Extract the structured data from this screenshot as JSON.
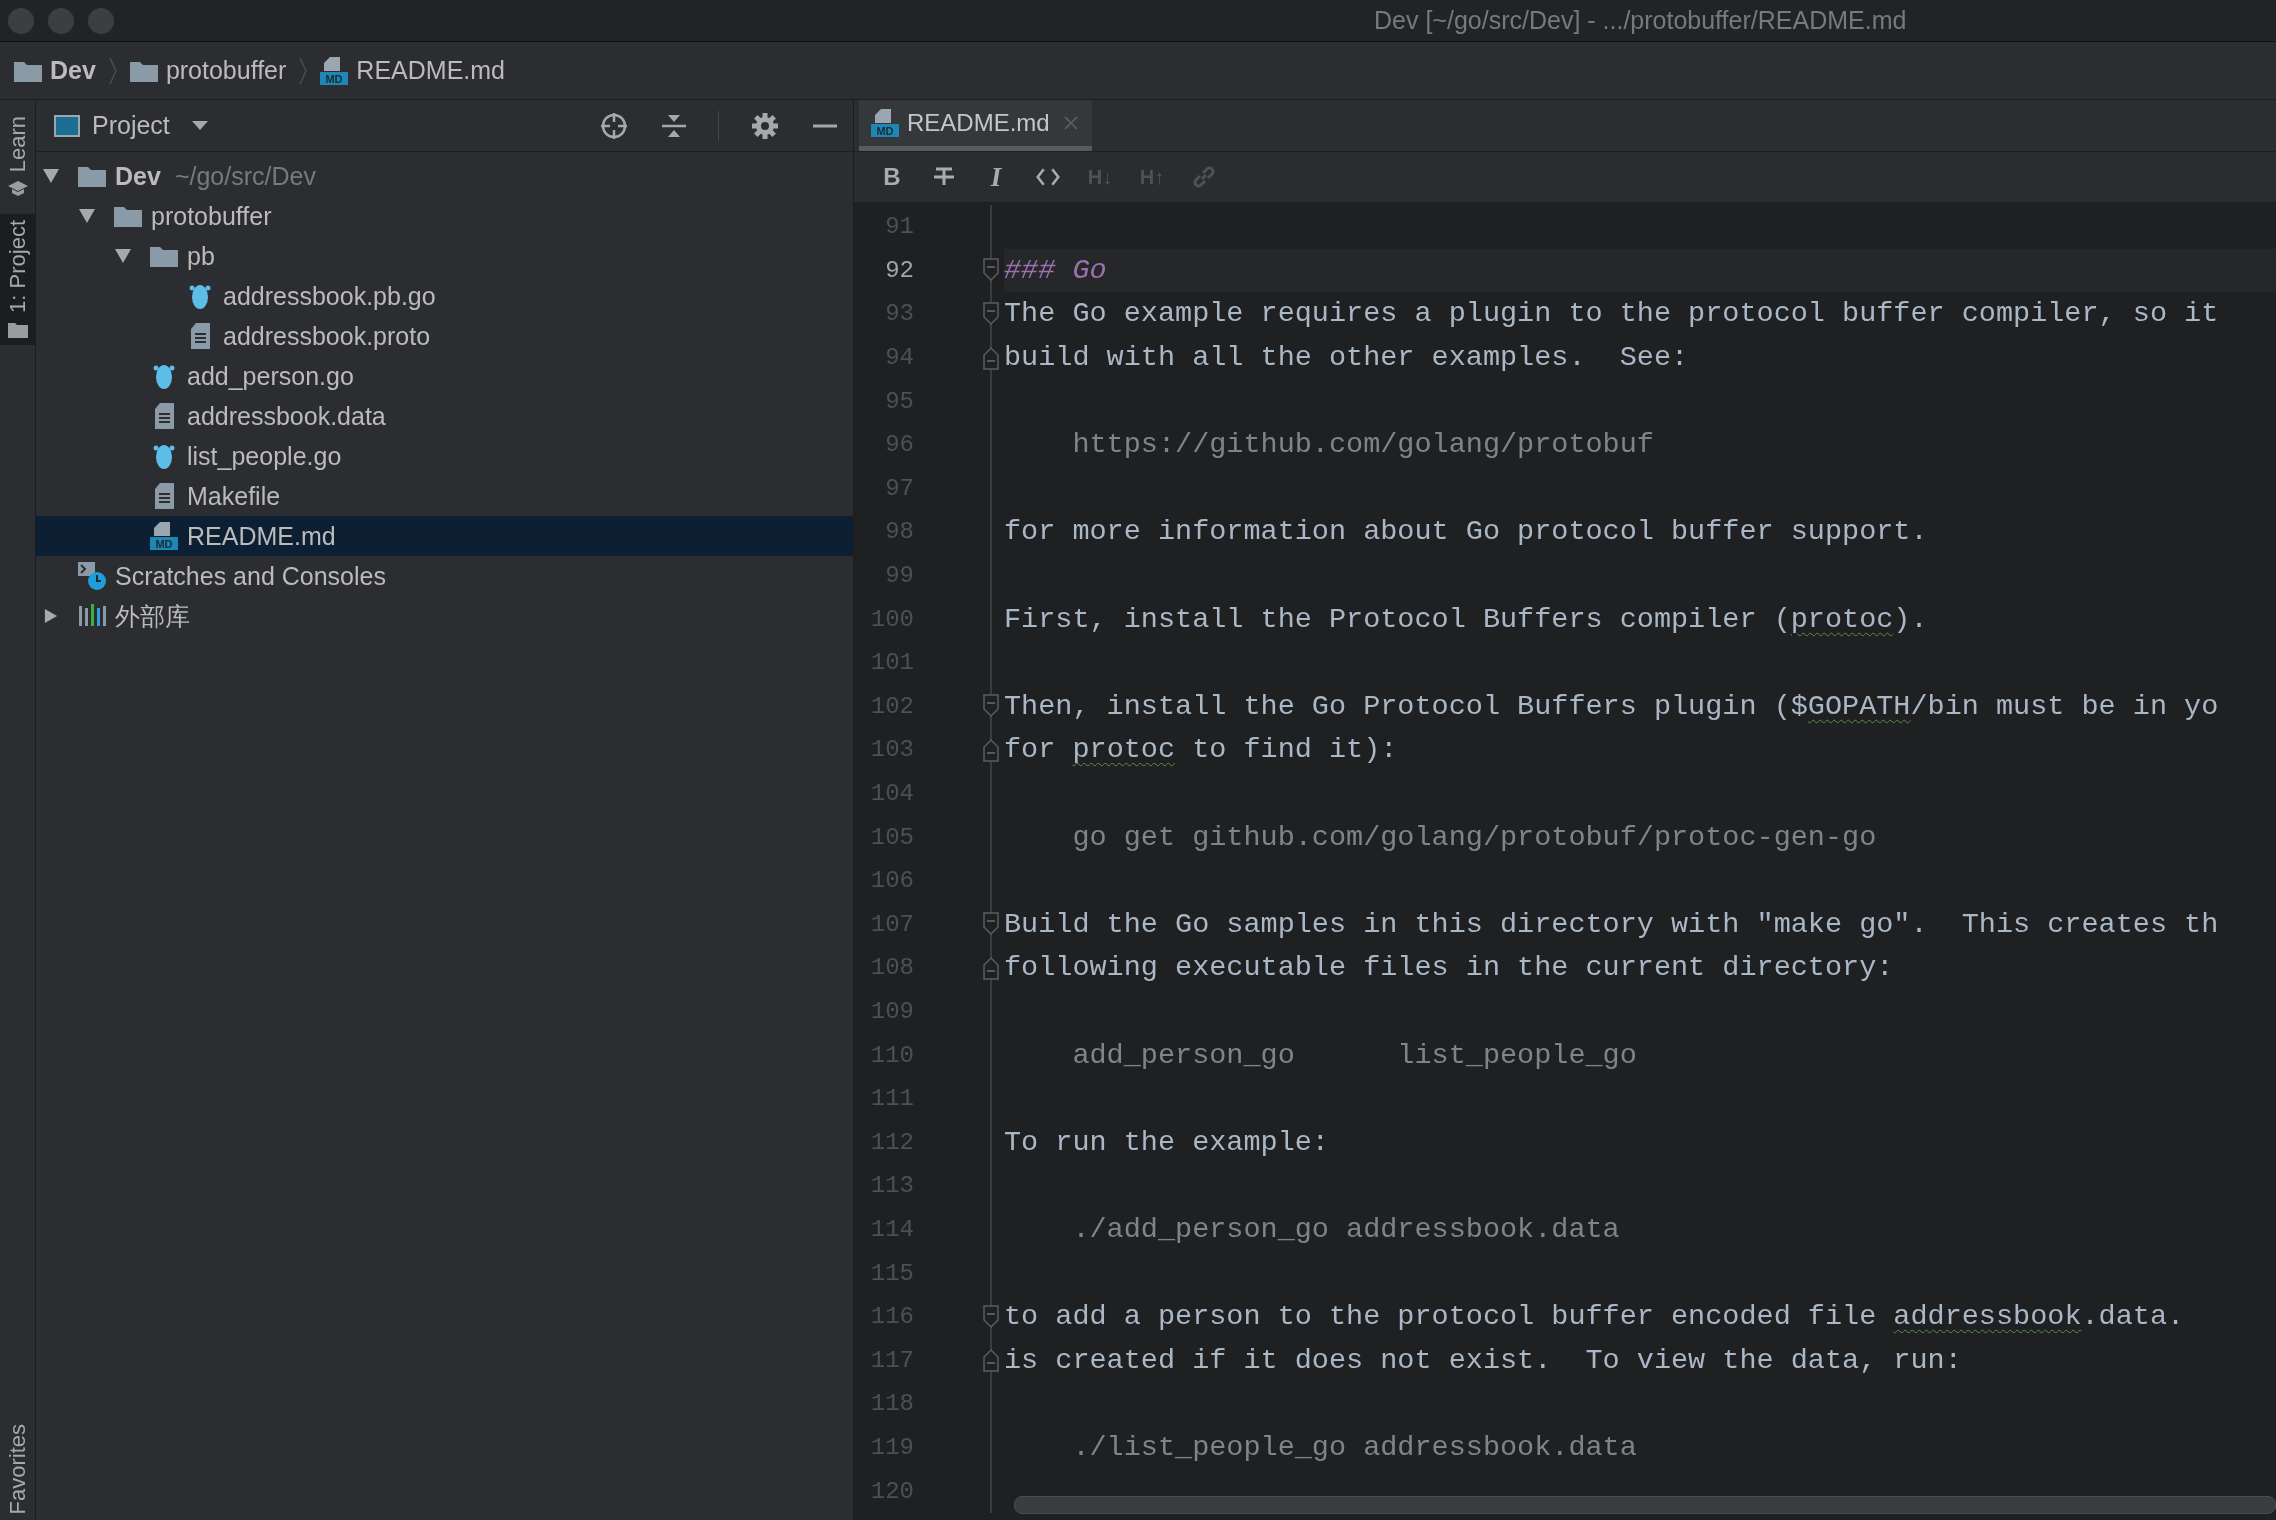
{
  "window": {
    "title": "Dev [~/go/src/Dev] - .../protobuffer/README.md"
  },
  "breadcrumbs": [
    {
      "label": "Dev",
      "kind": "folder",
      "bold": true
    },
    {
      "label": "protobuffer",
      "kind": "folder",
      "bold": false
    },
    {
      "label": "README.md",
      "kind": "markdown",
      "icon_label": "MD",
      "bold": false
    }
  ],
  "tool_strip": {
    "top": [
      {
        "label": "Learn",
        "kind": "cap",
        "selected": false
      },
      {
        "label": "1: Project",
        "kind": "folder",
        "selected": true
      }
    ],
    "bottom": [
      {
        "label": "Favorites",
        "selected": false
      }
    ]
  },
  "project": {
    "title": "Project",
    "tree": [
      {
        "label": "Dev",
        "hint": "~/go/src/Dev",
        "bold": true,
        "kind": "folder",
        "expanded": true,
        "selected": false,
        "children": [
          {
            "label": "protobuffer",
            "bold": false,
            "kind": "folder",
            "expanded": true,
            "selected": false,
            "children": [
              {
                "label": "pb",
                "bold": false,
                "kind": "folder",
                "expanded": true,
                "selected": false,
                "children": [
                  {
                    "label": "addressbook.pb.go",
                    "bold": false,
                    "kind": "go",
                    "selected": false
                  },
                  {
                    "label": "addressbook.proto",
                    "bold": false,
                    "kind": "file",
                    "selected": false
                  }
                ]
              },
              {
                "label": "add_person.go",
                "bold": false,
                "kind": "go",
                "selected": false
              },
              {
                "label": "addressbook.data",
                "bold": false,
                "kind": "file",
                "selected": false
              },
              {
                "label": "list_people.go",
                "bold": false,
                "kind": "go",
                "selected": false
              },
              {
                "label": "Makefile",
                "bold": false,
                "kind": "file",
                "selected": false
              },
              {
                "label": "README.md",
                "bold": false,
                "kind": "markdown",
                "icon_label": "MD",
                "selected": true
              }
            ]
          }
        ]
      },
      {
        "label": "Scratches and Consoles",
        "bold": false,
        "kind": "scratches",
        "selected": false
      },
      {
        "label": "外部库",
        "bold": false,
        "kind": "library",
        "expanded": false,
        "selected": false
      }
    ]
  },
  "editor": {
    "tabs": [
      {
        "label": "README.md",
        "kind": "markdown",
        "icon_label": "MD",
        "selected": true
      }
    ],
    "toolbar": [
      {
        "kind": "bold",
        "label": "B",
        "disabled": false
      },
      {
        "kind": "strike",
        "disabled": false
      },
      {
        "kind": "italic",
        "label": "I",
        "disabled": false
      },
      {
        "kind": "code",
        "disabled": false
      },
      {
        "kind": "header",
        "label": "H↓",
        "disabled": true
      },
      {
        "kind": "header",
        "label": "H↑",
        "disabled": true
      },
      {
        "kind": "link",
        "disabled": true
      }
    ],
    "lines": [
      {
        "number": "91",
        "current": false,
        "fold_start": false,
        "fold_end": false
      },
      {
        "number": "92",
        "kind": "heading",
        "current": true,
        "fold_start": true,
        "fold_end": false,
        "segments": [
          {
            "text": "### Go",
            "flagged": false
          }
        ]
      },
      {
        "number": "93",
        "kind": "text",
        "current": false,
        "fold_start": true,
        "fold_end": false,
        "segments": [
          {
            "text": "The Go example requires a plugin to the protocol buffer compiler, so it",
            "flagged": false
          }
        ]
      },
      {
        "number": "94",
        "kind": "text",
        "current": false,
        "fold_start": false,
        "fold_end": true,
        "segments": [
          {
            "text": "build with all the other examples.  See:",
            "flagged": false
          }
        ]
      },
      {
        "number": "95",
        "current": false,
        "fold_start": false,
        "fold_end": false
      },
      {
        "number": "96",
        "kind": "code",
        "current": false,
        "fold_start": false,
        "fold_end": false,
        "segments": [
          {
            "text": "    https://github.com/golang/protobuf",
            "flagged": false
          }
        ]
      },
      {
        "number": "97",
        "current": false,
        "fold_start": false,
        "fold_end": false
      },
      {
        "number": "98",
        "kind": "text",
        "current": false,
        "fold_start": false,
        "fold_end": false,
        "segments": [
          {
            "text": "for more information about Go protocol buffer support.",
            "flagged": false
          }
        ]
      },
      {
        "number": "99",
        "current": false,
        "fold_start": false,
        "fold_end": false
      },
      {
        "number": "100",
        "kind": "text",
        "current": false,
        "fold_start": false,
        "fold_end": false,
        "segments": [
          {
            "text": "First, install the Protocol Buffers compiler (",
            "flagged": false
          },
          {
            "text": "protoc",
            "flagged": true
          },
          {
            "text": ").",
            "flagged": false
          }
        ]
      },
      {
        "number": "101",
        "current": false,
        "fold_start": false,
        "fold_end": false
      },
      {
        "number": "102",
        "kind": "text",
        "current": false,
        "fold_start": true,
        "fold_end": false,
        "segments": [
          {
            "text": "Then, install the Go Protocol Buffers plugin ($",
            "flagged": false
          },
          {
            "text": "GOPATH",
            "flagged": true
          },
          {
            "text": "/bin must be in yo",
            "flagged": false
          }
        ]
      },
      {
        "number": "103",
        "kind": "text",
        "current": false,
        "fold_start": false,
        "fold_end": true,
        "segments": [
          {
            "text": "for ",
            "flagged": false
          },
          {
            "text": "protoc",
            "flagged": true
          },
          {
            "text": " to find it):",
            "flagged": false
          }
        ]
      },
      {
        "number": "104",
        "current": false,
        "fold_start": false,
        "fold_end": false
      },
      {
        "number": "105",
        "kind": "code",
        "current": false,
        "fold_start": false,
        "fold_end": false,
        "segments": [
          {
            "text": "    go get github.com/golang/protobuf/protoc-gen-go",
            "flagged": false
          }
        ]
      },
      {
        "number": "106",
        "current": false,
        "fold_start": false,
        "fold_end": false
      },
      {
        "number": "107",
        "kind": "text",
        "current": false,
        "fold_start": true,
        "fold_end": false,
        "segments": [
          {
            "text": "Build the Go samples in this directory with \"make go\".  This creates th",
            "flagged": false
          }
        ]
      },
      {
        "number": "108",
        "kind": "text",
        "current": false,
        "fold_start": false,
        "fold_end": true,
        "segments": [
          {
            "text": "following executable files in the current directory:",
            "flagged": false
          }
        ]
      },
      {
        "number": "109",
        "current": false,
        "fold_start": false,
        "fold_end": false
      },
      {
        "number": "110",
        "kind": "code",
        "current": false,
        "fold_start": false,
        "fold_end": false,
        "segments": [
          {
            "text": "    add_person_go      list_people_go",
            "flagged": false
          }
        ]
      },
      {
        "number": "111",
        "current": false,
        "fold_start": false,
        "fold_end": false
      },
      {
        "number": "112",
        "kind": "text",
        "current": false,
        "fold_start": false,
        "fold_end": false,
        "segments": [
          {
            "text": "To run the example:",
            "flagged": false
          }
        ]
      },
      {
        "number": "113",
        "current": false,
        "fold_start": false,
        "fold_end": false
      },
      {
        "number": "114",
        "kind": "code",
        "current": false,
        "fold_start": false,
        "fold_end": false,
        "segments": [
          {
            "text": "    ./add_person_go addressbook.data",
            "flagged": false
          }
        ]
      },
      {
        "number": "115",
        "current": false,
        "fold_start": false,
        "fold_end": false
      },
      {
        "number": "116",
        "kind": "text",
        "current": false,
        "fold_start": true,
        "fold_end": false,
        "segments": [
          {
            "text": "to add a person to the protocol buffer encoded file ",
            "flagged": false
          },
          {
            "text": "addressbook",
            "flagged": true
          },
          {
            "text": ".data.",
            "flagged": false
          }
        ]
      },
      {
        "number": "117",
        "kind": "text",
        "current": false,
        "fold_start": false,
        "fold_end": true,
        "segments": [
          {
            "text": "is created if it does not exist.  To view the data, run:",
            "flagged": false
          }
        ]
      },
      {
        "number": "118",
        "current": false,
        "fold_start": false,
        "fold_end": false
      },
      {
        "number": "119",
        "kind": "code",
        "current": false,
        "fold_start": false,
        "fold_end": false,
        "segments": [
          {
            "text": "    ./list_people_go addressbook.data",
            "flagged": false
          }
        ]
      },
      {
        "number": "120",
        "current": false,
        "fold_start": false,
        "fold_end": false
      }
    ]
  }
}
